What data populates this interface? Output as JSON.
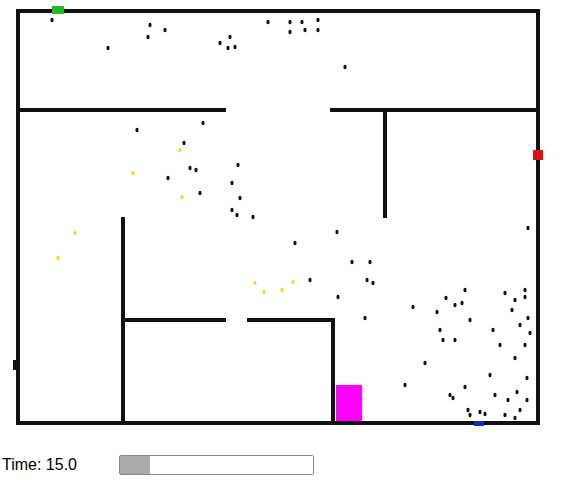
{
  "simulation": {
    "agent_groups": [
      {
        "name": "agents",
        "color": "#111111",
        "count": 80
      },
      {
        "name": "marked-agents",
        "color": "#f0e020",
        "count": 9
      }
    ],
    "markers": [
      {
        "name": "green-flag",
        "color": "#22bb22"
      },
      {
        "name": "red-flag",
        "color": "#dd1111"
      },
      {
        "name": "black-flag",
        "color": "#111111"
      },
      {
        "name": "blue-flag",
        "color": "#2222cc"
      }
    ],
    "exit": {
      "color": "#ff00ff"
    }
  },
  "status": {
    "time": "Time: 15.0",
    "progress": {
      "level": 0.155
    }
  }
}
